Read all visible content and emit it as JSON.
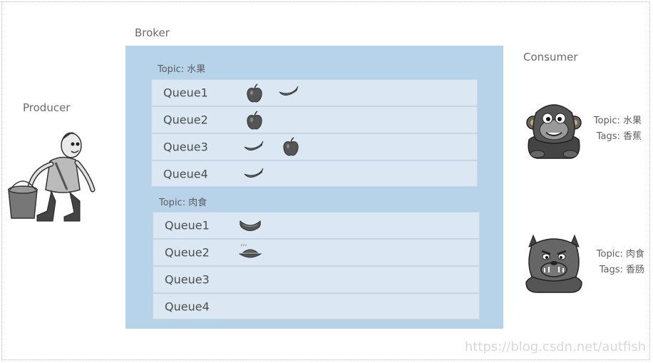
{
  "labels": {
    "broker": "Broker",
    "producer": "Producer",
    "consumer": "Consumer"
  },
  "topics": [
    {
      "label": "Topic: 水果",
      "queues": [
        {
          "name": "Queue1",
          "items": [
            "apple",
            "banana"
          ]
        },
        {
          "name": "Queue2",
          "items": [
            "apple"
          ]
        },
        {
          "name": "Queue3",
          "items": [
            "banana",
            "apple"
          ]
        },
        {
          "name": "Queue4",
          "items": [
            "banana"
          ]
        }
      ]
    },
    {
      "label": "Topic: 肉食",
      "queues": [
        {
          "name": "Queue1",
          "items": [
            "sausage"
          ]
        },
        {
          "name": "Queue2",
          "items": [
            "dish"
          ]
        },
        {
          "name": "Queue3",
          "items": []
        },
        {
          "name": "Queue4",
          "items": []
        }
      ]
    }
  ],
  "consumers": [
    {
      "icon": "gorilla-icon",
      "topic": "Topic: 水果",
      "tags": "Tags: 香蕉"
    },
    {
      "icon": "bulldog-icon",
      "topic": "Topic: 肉食",
      "tags": "Tags: 香肠"
    }
  ],
  "watermark": "https://blog.csdn.net/autfish"
}
